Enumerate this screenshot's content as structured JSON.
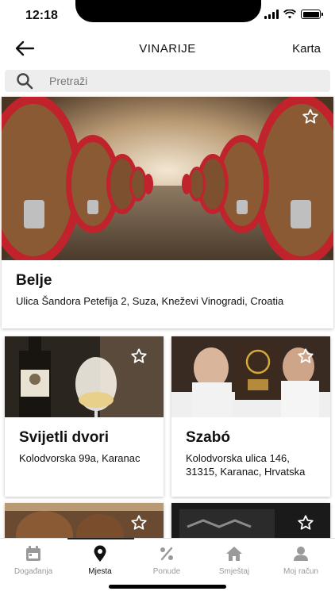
{
  "status": {
    "time": "12:18"
  },
  "header": {
    "back_icon": "arrow-left-icon",
    "title": "VINARIJE",
    "map_label": "Karta"
  },
  "search": {
    "placeholder": "Pretraži",
    "value": "",
    "icon": "search-icon"
  },
  "wineries": [
    {
      "name": "Belje",
      "address": "Ulica Šandora Petefija 2, Suza, Kneževi Vinogradi, Croatia"
    },
    {
      "name": "Svijetli dvori",
      "address": "Kolodvorska 99a, Karanac"
    },
    {
      "name": "Szabó",
      "address": "Kolodvorska ulica 146, 31315, Karanac, Hrvatska"
    }
  ],
  "tabs": [
    {
      "label": "Događanja",
      "icon": "calendar-icon"
    },
    {
      "label": "Mjesta",
      "icon": "map-pin-icon",
      "active": true
    },
    {
      "label": "Ponude",
      "icon": "percent-icon"
    },
    {
      "label": "Smještaj",
      "icon": "house-icon"
    },
    {
      "label": "Moj račun",
      "icon": "user-icon"
    }
  ],
  "colors": {
    "barrel_red": "#c0232b",
    "wood": "#8a5a34",
    "tab_active": "#111111",
    "tab_inactive": "#9a9a9a"
  }
}
